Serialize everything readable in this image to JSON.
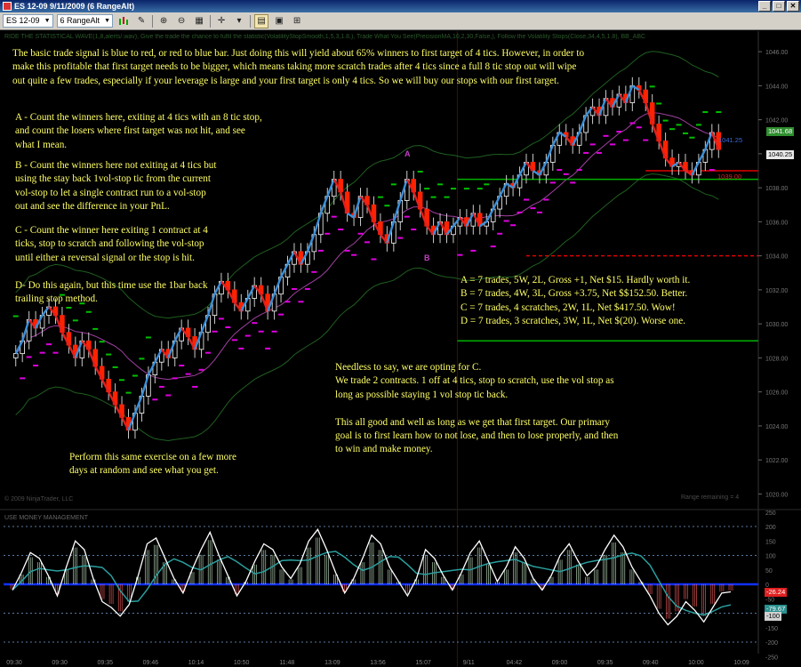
{
  "window": {
    "title": "ES 12-09  9/11/2009 (6 RangeAlt)",
    "min": "_",
    "max": "□",
    "close": "✕"
  },
  "toolbar": {
    "instrument": "ES 12-09",
    "interval": "6 RangeAlt"
  },
  "indicator_label": "RIDE THE STATISTICAL WAVE(1,8,alerts/.wav), Give the trade the chance to fulfil the statistic(VolatilityStopSmooth,1,5,3,1.8,), Trade What You See(PrecisionMA,10,2,30,False,), Follow the Volatility Stops(Close,34,4,5,1.8), BB_ABC",
  "notes": {
    "intro": "The basic trade signal is blue to red, or red to blue bar. Just doing this will yield about 65% winners to first target of 4 tics. However, in order to\nmake this profitable that first target needs to be bigger, which means taking more scratch trades after 4 tics since a full 8 tic stop out will wipe\nout quite a few trades, especially if your leverage is large and your first target is only 4 tics.  So we will buy our stops with our first target.",
    "a": "A - Count the winners here, exiting at 4 tics with an 8 tic stop,\nand count the losers where first target was not hit, and see\nwhat I mean.",
    "b": "B - Count the winners here not exiting at 4 tics but\nusing the stay back 1vol-stop tic from the current\nvol-stop to let a single contract run to a vol-stop\nout and see the difference in your PnL.",
    "c": "C - Count the winner here exiting 1 contract at 4\nticks, stop to scratch and following the vol-stop\nuntil either a reversal signal or the stop is hit.",
    "d": "D- Do this again, but this time use the 1bar back\ntrailing stop method.",
    "results": "A = 7 trades, 5W, 2L, Gross +1, Net $15. Hardly worth it.\nB = 7 trades, 4W, 3L, Gross +3.75, Net $$152.50. Better.\nC = 7 trades, 4 scratches, 2W, 1L, Net $417.50. Wow!\nD = 7 trades, 3 scratches, 3W, 1L, Net $(20). Worse one.",
    "conclusion": "Needless to say, we are opting for C.\nWe trade 2 contracts. 1 off at 4 tics,  stop to scratch, use the vol stop as\nlong as possible staying 1 vol stop tic back.\n\nThis all good and well as long as we get that first target. Our primary\ngoal is to first learn how to not lose, and then to lose properly, and then\nto win and make money.",
    "exercise": "Perform this same exercise on a few more\ndays at random and see what you get."
  },
  "labels": {
    "a": "A",
    "b": "B"
  },
  "copyright": "© 2009 NinjaTrader, LLC",
  "range_remaining": "Range remaining = 4",
  "lower_panel_label": "USE MONEY MANAGEMENT",
  "price_badges": {
    "upper": "1041.68",
    "current": "1040.25",
    "target": "1041.25",
    "stop": "1039.00",
    "mm_a": "-26.24",
    "mm_b": "-79.67",
    "mm_c": "-100"
  },
  "colors": {
    "up_bar": "#ffffff",
    "down_bar": "#ff2200",
    "trend_up": "#3a8fd8",
    "trend_down": "#e02020",
    "stop_up": "#00c000",
    "stop_down": "#e000e0",
    "band": "#1f5f1f",
    "ma": "#a040a0",
    "note_text": "#ffff66"
  },
  "chart_data": [
    {
      "type": "candlestick",
      "title": "ES 12-09 9/11/2009 (6 RangeAlt)",
      "ylim": [
        1019.5,
        1047
      ],
      "y_ticks": [
        1020,
        1022,
        1024,
        1026,
        1028,
        1030,
        1032,
        1034,
        1036,
        1038,
        1040,
        1042,
        1044,
        1046
      ],
      "x_ticks": [
        "09:30",
        "09:30",
        "09:35",
        "09:46",
        "10:14",
        "10:50",
        "11:48",
        "13:09",
        "13:56",
        "15:07",
        "9/11",
        "04:42",
        "09:00",
        "09:35",
        "09:40",
        "10:00",
        "10:09"
      ],
      "close": [
        1028.25,
        1029.0,
        1030.25,
        1029.75,
        1030.5,
        1031.0,
        1030.5,
        1029.5,
        1028.75,
        1028.0,
        1029.0,
        1028.5,
        1027.5,
        1026.75,
        1026.0,
        1025.25,
        1024.5,
        1023.75,
        1024.75,
        1025.75,
        1027.0,
        1027.75,
        1028.5,
        1028.0,
        1029.0,
        1029.75,
        1029.25,
        1028.5,
        1029.5,
        1030.5,
        1031.75,
        1032.5,
        1032.0,
        1031.25,
        1030.75,
        1031.5,
        1032.25,
        1031.75,
        1030.75,
        1031.75,
        1032.75,
        1033.5,
        1034.25,
        1033.5,
        1034.25,
        1035.25,
        1036.5,
        1037.5,
        1038.5,
        1037.75,
        1036.5,
        1036.25,
        1037.5,
        1037.0,
        1036.0,
        1035.25,
        1034.75,
        1036.0,
        1037.25,
        1038.5,
        1037.75,
        1036.75,
        1035.75,
        1035.25,
        1036.0,
        1035.25,
        1035.75,
        1036.25,
        1035.75,
        1036.5,
        1035.75,
        1036.0,
        1036.75,
        1037.5,
        1038.25,
        1038.0,
        1038.75,
        1039.5,
        1039.0,
        1038.75,
        1039.5,
        1040.5,
        1041.25,
        1041.0,
        1040.5,
        1041.25,
        1042.25,
        1042.75,
        1042.25,
        1043.25,
        1042.75,
        1043.5,
        1043.0,
        1044.0,
        1043.75,
        1043.0,
        1041.75,
        1040.75,
        1039.75,
        1039.25,
        1039.5,
        1039.0,
        1038.75,
        1039.5,
        1040.25,
        1041.25,
        1040.25
      ],
      "open": [
        1028.0,
        1028.25,
        1029.0,
        1030.25,
        1029.75,
        1030.5,
        1031.0,
        1030.5,
        1029.5,
        1028.75,
        1028.0,
        1029.0,
        1028.5,
        1027.5,
        1026.75,
        1026.0,
        1025.25,
        1024.5,
        1023.75,
        1024.75,
        1025.75,
        1027.0,
        1027.75,
        1028.5,
        1028.0,
        1029.0,
        1029.75,
        1029.25,
        1028.5,
        1029.5,
        1030.5,
        1031.75,
        1032.5,
        1032.0,
        1031.25,
        1030.75,
        1031.5,
        1032.25,
        1031.75,
        1030.75,
        1031.75,
        1032.75,
        1033.5,
        1034.25,
        1033.5,
        1034.25,
        1035.25,
        1036.5,
        1037.5,
        1038.5,
        1037.75,
        1036.5,
        1036.25,
        1037.5,
        1037.0,
        1036.0,
        1035.25,
        1034.75,
        1036.0,
        1037.25,
        1038.5,
        1037.75,
        1036.75,
        1035.75,
        1035.25,
        1036.0,
        1035.25,
        1035.75,
        1036.25,
        1035.75,
        1036.5,
        1035.75,
        1036.0,
        1036.75,
        1037.5,
        1038.25,
        1038.0,
        1038.75,
        1039.5,
        1039.0,
        1038.75,
        1039.5,
        1040.5,
        1041.25,
        1041.0,
        1040.5,
        1041.25,
        1042.25,
        1042.75,
        1042.25,
        1043.25,
        1042.75,
        1043.5,
        1043.0,
        1044.0,
        1043.75,
        1043.0,
        1041.75,
        1040.75,
        1039.75,
        1039.25,
        1039.5,
        1039.0,
        1038.75,
        1039.5,
        1040.25,
        1041.25
      ],
      "horizontal_lines": [
        {
          "value": 1038.5,
          "color": "#00b000"
        },
        {
          "value": 1039.0,
          "color": "#e00000"
        },
        {
          "value": 1034.0,
          "color": "#e00000",
          "dashed": true
        },
        {
          "value": 1029.0,
          "color": "#00b000"
        }
      ]
    },
    {
      "type": "line",
      "title": "USE MONEY MANAGEMENT",
      "ylim": [
        -240,
        240
      ],
      "y_ticks": [
        250,
        200,
        150,
        100,
        50,
        0,
        -50,
        -100,
        -150,
        -200,
        -250
      ],
      "values": [
        -20,
        40,
        110,
        90,
        30,
        -40,
        60,
        150,
        120,
        20,
        -60,
        -80,
        -110,
        -70,
        30,
        140,
        160,
        90,
        20,
        -30,
        50,
        120,
        180,
        100,
        30,
        -40,
        10,
        80,
        140,
        120,
        60,
        20,
        70,
        150,
        190,
        120,
        40,
        -30,
        20,
        90,
        170,
        140,
        60,
        10,
        -40,
        20,
        120,
        90,
        30,
        -20,
        40,
        110,
        150,
        80,
        10,
        60,
        130,
        90,
        20,
        -20,
        30,
        100,
        140,
        80,
        30,
        60,
        120,
        170,
        130,
        60,
        10,
        -40,
        -100,
        -140,
        -110,
        -60,
        -90,
        -130,
        -80,
        -30,
        -26
      ]
    }
  ]
}
